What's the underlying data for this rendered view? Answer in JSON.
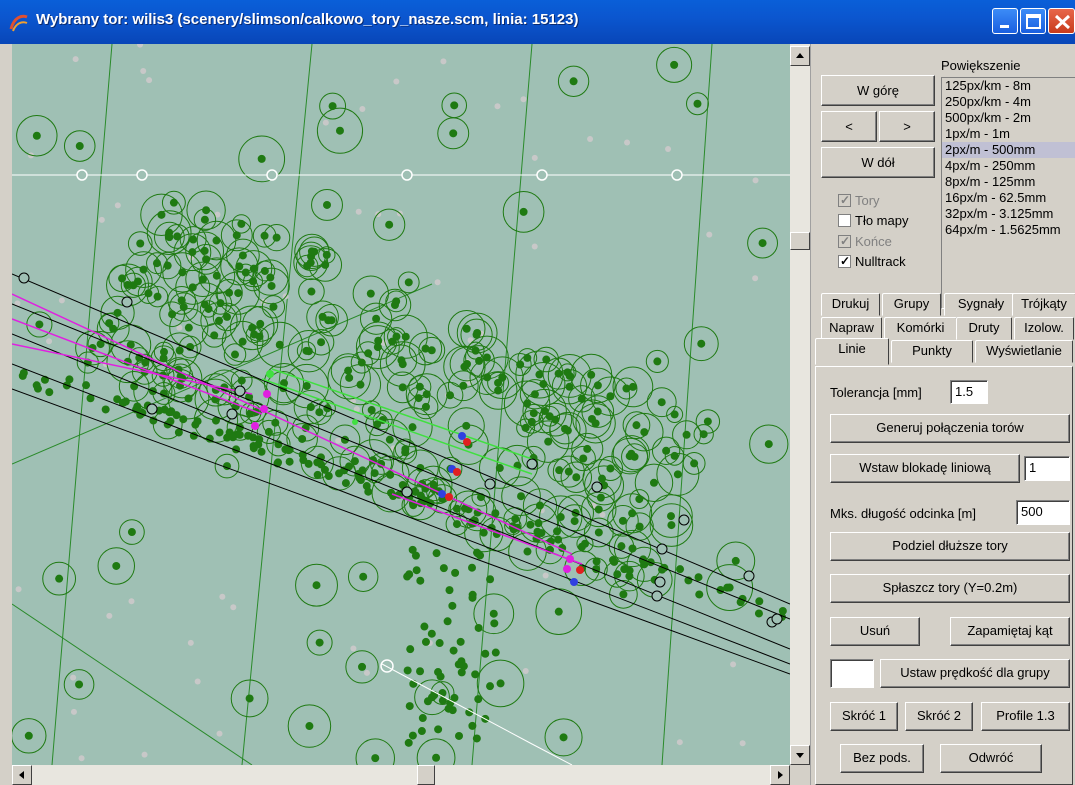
{
  "window": {
    "title": "Wybrany tor: wilis3 (scenery/slimson/calkowo_tory_nasze.scm, linia: 15123)"
  },
  "navigation": {
    "up_label": "W górę",
    "left_label": "<",
    "right_label": ">",
    "down_label": "W dół"
  },
  "zoom": {
    "label": "Powiększenie",
    "options": [
      "125px/km - 8m",
      "250px/km - 4m",
      "500px/km - 2m",
      "1px/m - 1m",
      "2px/m - 500mm",
      "4px/m - 250mm",
      "8px/m - 125mm",
      "16px/m - 62.5mm",
      "32px/m - 3.125mm",
      "64px/m - 1.5625mm"
    ],
    "selected_index": 4
  },
  "layers": [
    {
      "label": "Tory",
      "checked": true,
      "disabled": true
    },
    {
      "label": "Tło mapy",
      "checked": false,
      "disabled": false
    },
    {
      "label": "Końce",
      "checked": true,
      "disabled": true
    },
    {
      "label": "Nulltrack",
      "checked": true,
      "disabled": false
    }
  ],
  "tabs": {
    "row1": [
      "Drukuj",
      "Grupy",
      "Sygnały",
      "Trójkąty"
    ],
    "row2": [
      "Napraw",
      "Komórki",
      "Druty",
      "Izolow."
    ],
    "row3": [
      "Linie",
      "Punkty",
      "Wyświetlanie"
    ],
    "active": "Linie"
  },
  "linie": {
    "tolerance_label": "Tolerancja [mm]",
    "tolerance_value": "1.5",
    "generate_label": "Generuj połączenia torów",
    "insert_block_label": "Wstaw blokadę liniową",
    "insert_block_value": "1",
    "max_length_label": "Mks. długość odcinka [m]",
    "max_length_value": "500",
    "split_label": "Podziel dłuższe tory",
    "flatten_label": "Spłaszcz tory (Y=0.2m)",
    "delete_label": "Usuń",
    "remember_angle_label": "Zapamiętaj kąt",
    "speed_value": "",
    "set_speed_label": "Ustaw prędkość dla grupy",
    "shorten1_label": "Skróć 1",
    "shorten2_label": "Skróć 2",
    "profile_label": "Profile 1.3",
    "no_sub_label": "Bez pods.",
    "reverse_label": "Odwróć"
  },
  "colors": {
    "map_background": "#9fc0b4",
    "tree": "#1f7a12",
    "track": "#000000",
    "selected_track": "#e020e0",
    "highlight_track": "#40e040",
    "white_line": "#ffffff"
  }
}
